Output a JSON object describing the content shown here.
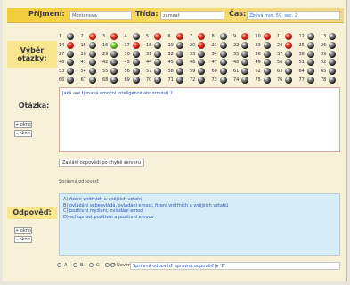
{
  "header": {
    "surname_label": "Příjmení:",
    "surname_value": "Montenova",
    "class_label": "Třída:",
    "class_value": "zameat",
    "time_label": "Čas:",
    "time_value": "Zbývá min. 59. sec. 2"
  },
  "sidebar": {
    "question_select_label": "Výběr otázky:",
    "question_label": "Otázka:",
    "answer_label": "Odpověď:",
    "window_plus": "+ okno",
    "window_minus": "- okno"
  },
  "grid": {
    "rows": [
      [
        "1",
        "2",
        "3",
        "4",
        "5",
        "6",
        "7",
        "8",
        "9",
        "10",
        "11",
        "12",
        "13"
      ],
      [
        "14",
        "15",
        "16",
        "17",
        "18",
        "19",
        "20",
        "21",
        "22",
        "23",
        "24",
        "25",
        "26"
      ],
      [
        "27",
        "28",
        "29",
        "30",
        "31",
        "32",
        "33",
        "34",
        "35",
        "36",
        "37",
        "38",
        "39"
      ],
      [
        "40",
        "41",
        "42",
        "43",
        "44",
        "45",
        "46",
        "47",
        "48",
        "49",
        "50",
        "51",
        "52"
      ],
      [
        "53",
        "54",
        "55",
        "56",
        "57",
        "58",
        "59",
        "60",
        "61",
        "62",
        "63",
        "64",
        "65"
      ],
      [
        "66",
        "67",
        "68",
        "69",
        "70",
        "71",
        "72",
        "73",
        "74",
        "75",
        "76",
        "77",
        "78"
      ]
    ],
    "dot_states": [
      [
        "black",
        "red",
        "red",
        "black",
        "red",
        "red",
        "red",
        "black",
        "red",
        "red",
        "red",
        "black",
        "black"
      ],
      [
        "red",
        "black",
        "green",
        "red",
        "black",
        "black",
        "red",
        "black",
        "black",
        "black",
        "red",
        "black",
        "black"
      ],
      [
        "black",
        "black",
        "black",
        "black",
        "black",
        "black",
        "black",
        "black",
        "black",
        "black",
        "black",
        "black",
        "black"
      ],
      [
        "black",
        "black",
        "black",
        "black",
        "black",
        "black",
        "black",
        "black",
        "black",
        "black",
        "black",
        "black",
        "black"
      ],
      [
        "black",
        "black",
        "black",
        "black",
        "black",
        "black",
        "black",
        "black",
        "black",
        "black",
        "black",
        "black",
        "black"
      ],
      [
        "black",
        "black",
        "black",
        "black",
        "black",
        "black",
        "black",
        "black",
        "black",
        "black",
        "black",
        "black",
        "black"
      ]
    ]
  },
  "question": {
    "text": "Jaká are tjímavá emoční inteligence abnormosti ?"
  },
  "error_button": "Zaslání odpovědi po chybě serveru",
  "correct_answers_label": "Správná odpověď:",
  "answers": [
    "A)   řízení vnitřních a vnějších vztahů",
    "B)   ovládání sebeovládá, ovládání emocí, řízení vnitřních a vnějších vztahů",
    "C)   pozitivní myšlení, ovládání emocí",
    "D)   schopnost pozitivní a pozitivní emoce"
  ],
  "answer_options": [
    "A",
    "B",
    "C",
    "D"
  ],
  "unseen_label": "Nevím",
  "answer_hint": "Správná odpověď: správná odpověď je 'B'"
}
